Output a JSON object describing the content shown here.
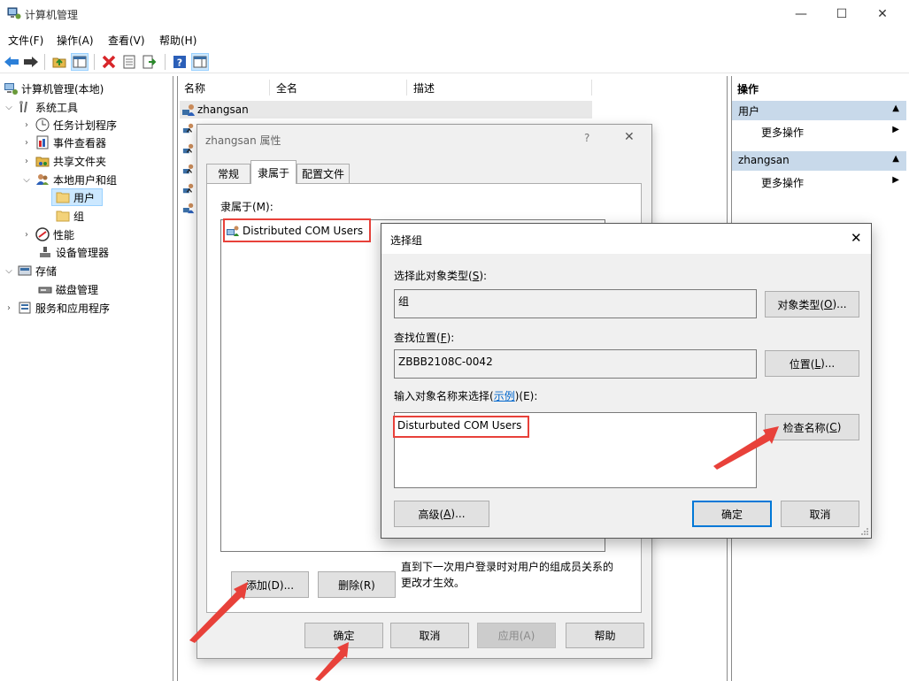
{
  "window": {
    "title": "计算机管理",
    "minimize": "—",
    "maximize": "☐",
    "close": "✕"
  },
  "menu": [
    "文件(F)",
    "操作(A)",
    "查看(V)",
    "帮助(H)"
  ],
  "tree": {
    "root": "计算机管理(本地)",
    "system_tools": "系统工具",
    "task_scheduler": "任务计划程序",
    "event_viewer": "事件查看器",
    "shared_folders": "共享文件夹",
    "local_users_groups": "本地用户和组",
    "users": "用户",
    "groups": "组",
    "performance": "性能",
    "device_manager": "设备管理器",
    "storage": "存储",
    "disk_management": "磁盘管理",
    "services_apps": "服务和应用程序"
  },
  "list": {
    "columns": [
      "名称",
      "全名",
      "描述"
    ],
    "rows": [
      "zhangsan"
    ]
  },
  "actions": {
    "header": "操作",
    "group1": "用户",
    "group1_item": "更多操作",
    "group2": "zhangsan",
    "group2_item": "更多操作"
  },
  "prop_dialog": {
    "title": "zhangsan 属性",
    "help": "?",
    "close": "✕",
    "tabs": [
      "常规",
      "隶属于",
      "配置文件"
    ],
    "member_of_label": "隶属于(M):",
    "member_item": "Distributed COM Users",
    "add": "添加(D)...",
    "remove": "删除(R)",
    "note": "直到下一次用户登录时对用户的组成员关系的更改才生效。",
    "ok": "确定",
    "cancel": "取消",
    "apply": "应用(A)",
    "help_btn": "帮助"
  },
  "select_dialog": {
    "title": "选择组",
    "close": "✕",
    "object_type_label_pre": "选择此对象类型(",
    "object_type_label_key": "S",
    "object_type_label_post": "):",
    "object_type_value": "组",
    "object_type_btn_pre": "对象类型(",
    "object_type_btn_key": "O",
    "object_type_btn_post": ")...",
    "location_label_pre": "查找位置(",
    "location_label_key": "F",
    "location_label_post": "):",
    "location_value": "ZBBB2108C-0042",
    "location_btn_pre": "位置(",
    "location_btn_key": "L",
    "location_btn_post": ")...",
    "enter_label_pre": "输入对象名称来选择(",
    "enter_label_link": "示例",
    "enter_label_post": ")(E):",
    "enter_value": "Disturbuted COM Users",
    "check_names_pre": "检查名称(",
    "check_names_key": "C",
    "check_names_post": ")",
    "advanced_pre": "高级(",
    "advanced_key": "A",
    "advanced_post": ")...",
    "ok": "确定",
    "cancel": "取消"
  },
  "colors": {
    "annotation": "#e8413a",
    "accent": "#0078d7",
    "selected": "#cce8ff"
  }
}
